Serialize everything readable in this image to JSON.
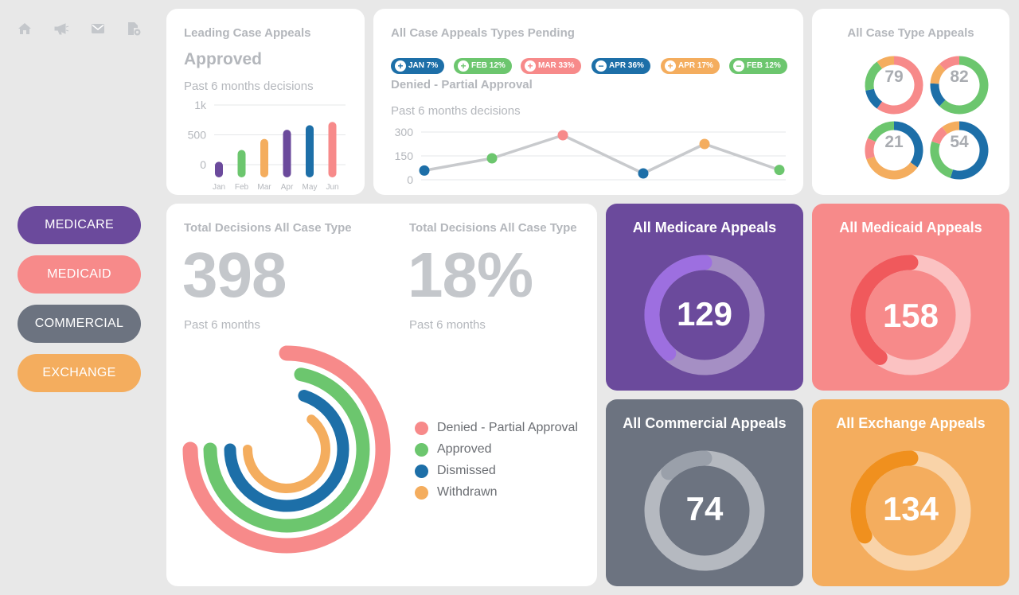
{
  "icons": [
    {
      "name": "home-icon"
    },
    {
      "name": "megaphone-icon"
    },
    {
      "name": "mail-icon"
    },
    {
      "name": "document-settings-icon"
    }
  ],
  "nav": {
    "items": [
      {
        "label": "MEDICARE",
        "color": "#6b4a9c"
      },
      {
        "label": "MEDICAID",
        "color": "#f78a8a"
      },
      {
        "label": "COMMERCIAL",
        "color": "#6c7380"
      },
      {
        "label": "EXCHANGE",
        "color": "#f4ad5e"
      }
    ]
  },
  "leading": {
    "title": "Leading Case Appeals",
    "status": "Approved",
    "subtitle": "Past 6 months decisions"
  },
  "pending": {
    "title": "All Case Appeals Types Pending",
    "status": "Denied - Partial Approval",
    "subtitle": "Past 6 months decisions",
    "pills": [
      {
        "label": "JAN 7%",
        "sign": "+",
        "color": "#1d6fa8"
      },
      {
        "label": "FEB 12%",
        "sign": "+",
        "color": "#6cc66e"
      },
      {
        "label": "MAR 33%",
        "sign": "+",
        "color": "#f78a8a"
      },
      {
        "label": "APR 36%",
        "sign": "−",
        "color": "#1d6fa8"
      },
      {
        "label": "APR 17%",
        "sign": "+",
        "color": "#f4ad5e"
      },
      {
        "label": "FEB 12%",
        "sign": "−",
        "color": "#6cc66e"
      }
    ]
  },
  "case_type": {
    "title": "All Case Type Appeals",
    "donuts": [
      {
        "value": "79",
        "segments": [
          {
            "color": "#f78a8a",
            "frac": 0.6
          },
          {
            "color": "#1d6fa8",
            "frac": 0.12
          },
          {
            "color": "#6cc66e",
            "frac": 0.18
          },
          {
            "color": "#f4ad5e",
            "frac": 0.1
          }
        ]
      },
      {
        "value": "82",
        "segments": [
          {
            "color": "#6cc66e",
            "frac": 0.62
          },
          {
            "color": "#1d6fa8",
            "frac": 0.14
          },
          {
            "color": "#f4ad5e",
            "frac": 0.12
          },
          {
            "color": "#f78a8a",
            "frac": 0.12
          }
        ]
      },
      {
        "value": "21",
        "segments": [
          {
            "color": "#1d6fa8",
            "frac": 0.35
          },
          {
            "color": "#f4ad5e",
            "frac": 0.35
          },
          {
            "color": "#f78a8a",
            "frac": 0.12
          },
          {
            "color": "#6cc66e",
            "frac": 0.18
          }
        ]
      },
      {
        "value": "54",
        "segments": [
          {
            "color": "#1d6fa8",
            "frac": 0.55
          },
          {
            "color": "#6cc66e",
            "frac": 0.25
          },
          {
            "color": "#f78a8a",
            "frac": 0.1
          },
          {
            "color": "#f4ad5e",
            "frac": 0.1
          }
        ]
      }
    ]
  },
  "totals": {
    "left_title": "Total Decisions All Case Type",
    "left_value": "398",
    "left_sub": "Past 6 months",
    "right_title": "Total Decisions All Case Type",
    "right_value": "18%",
    "right_sub": "Past 6 months",
    "legend": [
      {
        "label": "Denied - Partial Approval",
        "color": "#f78a8a"
      },
      {
        "label": "Approved",
        "color": "#6cc66e"
      },
      {
        "label": "Dismissed",
        "color": "#1d6fa8"
      },
      {
        "label": "Withdrawn",
        "color": "#f4ad5e"
      }
    ]
  },
  "panels": [
    {
      "title": "All Medicare Appeals",
      "value": "129",
      "bg": "#6b4a9c",
      "track": "#a58fc4",
      "fill": "#9d6fe0",
      "progress": 0.38,
      "num_color": "#ffffff"
    },
    {
      "title": "All Medicaid Appeals",
      "value": "158",
      "bg": "#f78a8a",
      "track": "#fbc2c2",
      "fill": "#f0595c",
      "progress": 0.4,
      "num_color": "#ffffff"
    },
    {
      "title": "All Commercial Appeals",
      "value": "74",
      "bg": "#6c7380",
      "track": "#b5b9c0",
      "fill": "#9aa0aa",
      "progress": 0.12,
      "num_color": "#ffffff"
    },
    {
      "title": "All Exchange Appeals",
      "value": "134",
      "bg": "#f4ad5e",
      "track": "#f9d3a8",
      "fill": "#f0901e",
      "progress": 0.33,
      "num_color": "#ffffff"
    }
  ],
  "chart_data": [
    {
      "type": "bar",
      "categories": [
        "Jan",
        "Feb",
        "Mar",
        "Apr",
        "May",
        "Jun"
      ],
      "values": [
        240,
        420,
        590,
        730,
        800,
        850
      ],
      "colors": [
        "#6b4a9c",
        "#6cc66e",
        "#f4ad5e",
        "#6b4a9c",
        "#1d6fa8",
        "#f78a8a"
      ],
      "yticks": [
        "1k",
        "500",
        "0"
      ],
      "ylim": [
        0,
        1000
      ],
      "grid": true
    },
    {
      "type": "line",
      "x": [
        1,
        2,
        3,
        4,
        5,
        6
      ],
      "values": [
        88,
        165,
        310,
        70,
        255,
        92
      ],
      "point_colors": [
        "#1d6fa8",
        "#6cc66e",
        "#f78a8a",
        "#1d6fa8",
        "#f4ad5e",
        "#6cc66e"
      ],
      "yticks": [
        "300",
        "150",
        "0"
      ],
      "ylim": [
        0,
        300
      ],
      "grid": true
    },
    {
      "type": "radial-bar",
      "series": [
        {
          "name": "Denied - Partial Approval",
          "value": 0.75,
          "color": "#f78a8a"
        },
        {
          "name": "Approved",
          "value": 0.72,
          "color": "#6cc66e"
        },
        {
          "name": "Dismissed",
          "value": 0.7,
          "color": "#1d6fa8"
        },
        {
          "name": "Withdrawn",
          "value": 0.64,
          "color": "#f4ad5e"
        }
      ]
    }
  ]
}
